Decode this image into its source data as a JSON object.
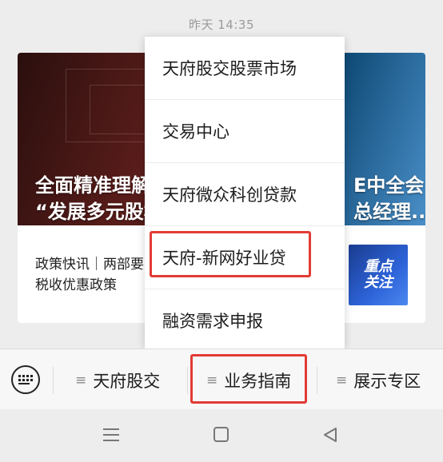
{
  "timestamp": "昨天 14:35",
  "article": {
    "hero_left_line1": "全面精准理解",
    "hero_left_line2": "“发展多元股杉",
    "hero_right_line1": "E中全会",
    "hero_right_line2": "总经理...",
    "body_text": "政策快讯｜两部要税收优惠政策",
    "thumb_line1": "重点",
    "thumb_line2": "关注"
  },
  "popup_menu": {
    "items": [
      {
        "label": "天府股交股票市场"
      },
      {
        "label": "交易中心"
      },
      {
        "label": "天府微众科创贷款"
      },
      {
        "label": "天府-新网好业贷",
        "highlighted": true
      },
      {
        "label": "融资需求申报"
      }
    ]
  },
  "bottom_menu": {
    "keyboard_icon": "keyboard-icon",
    "tabs": [
      {
        "label": "天府股交",
        "icon": "menu-lines-icon"
      },
      {
        "label": "业务指南",
        "icon": "menu-lines-icon",
        "highlighted": true
      },
      {
        "label": "展示专区",
        "icon": "menu-lines-icon"
      }
    ]
  },
  "navigation_bar": {
    "icons": [
      "recent-apps-icon",
      "home-icon",
      "back-icon"
    ]
  },
  "colors": {
    "highlight": "#e33b35",
    "background": "#ededed",
    "timestamp_text": "#9a9a9a"
  }
}
